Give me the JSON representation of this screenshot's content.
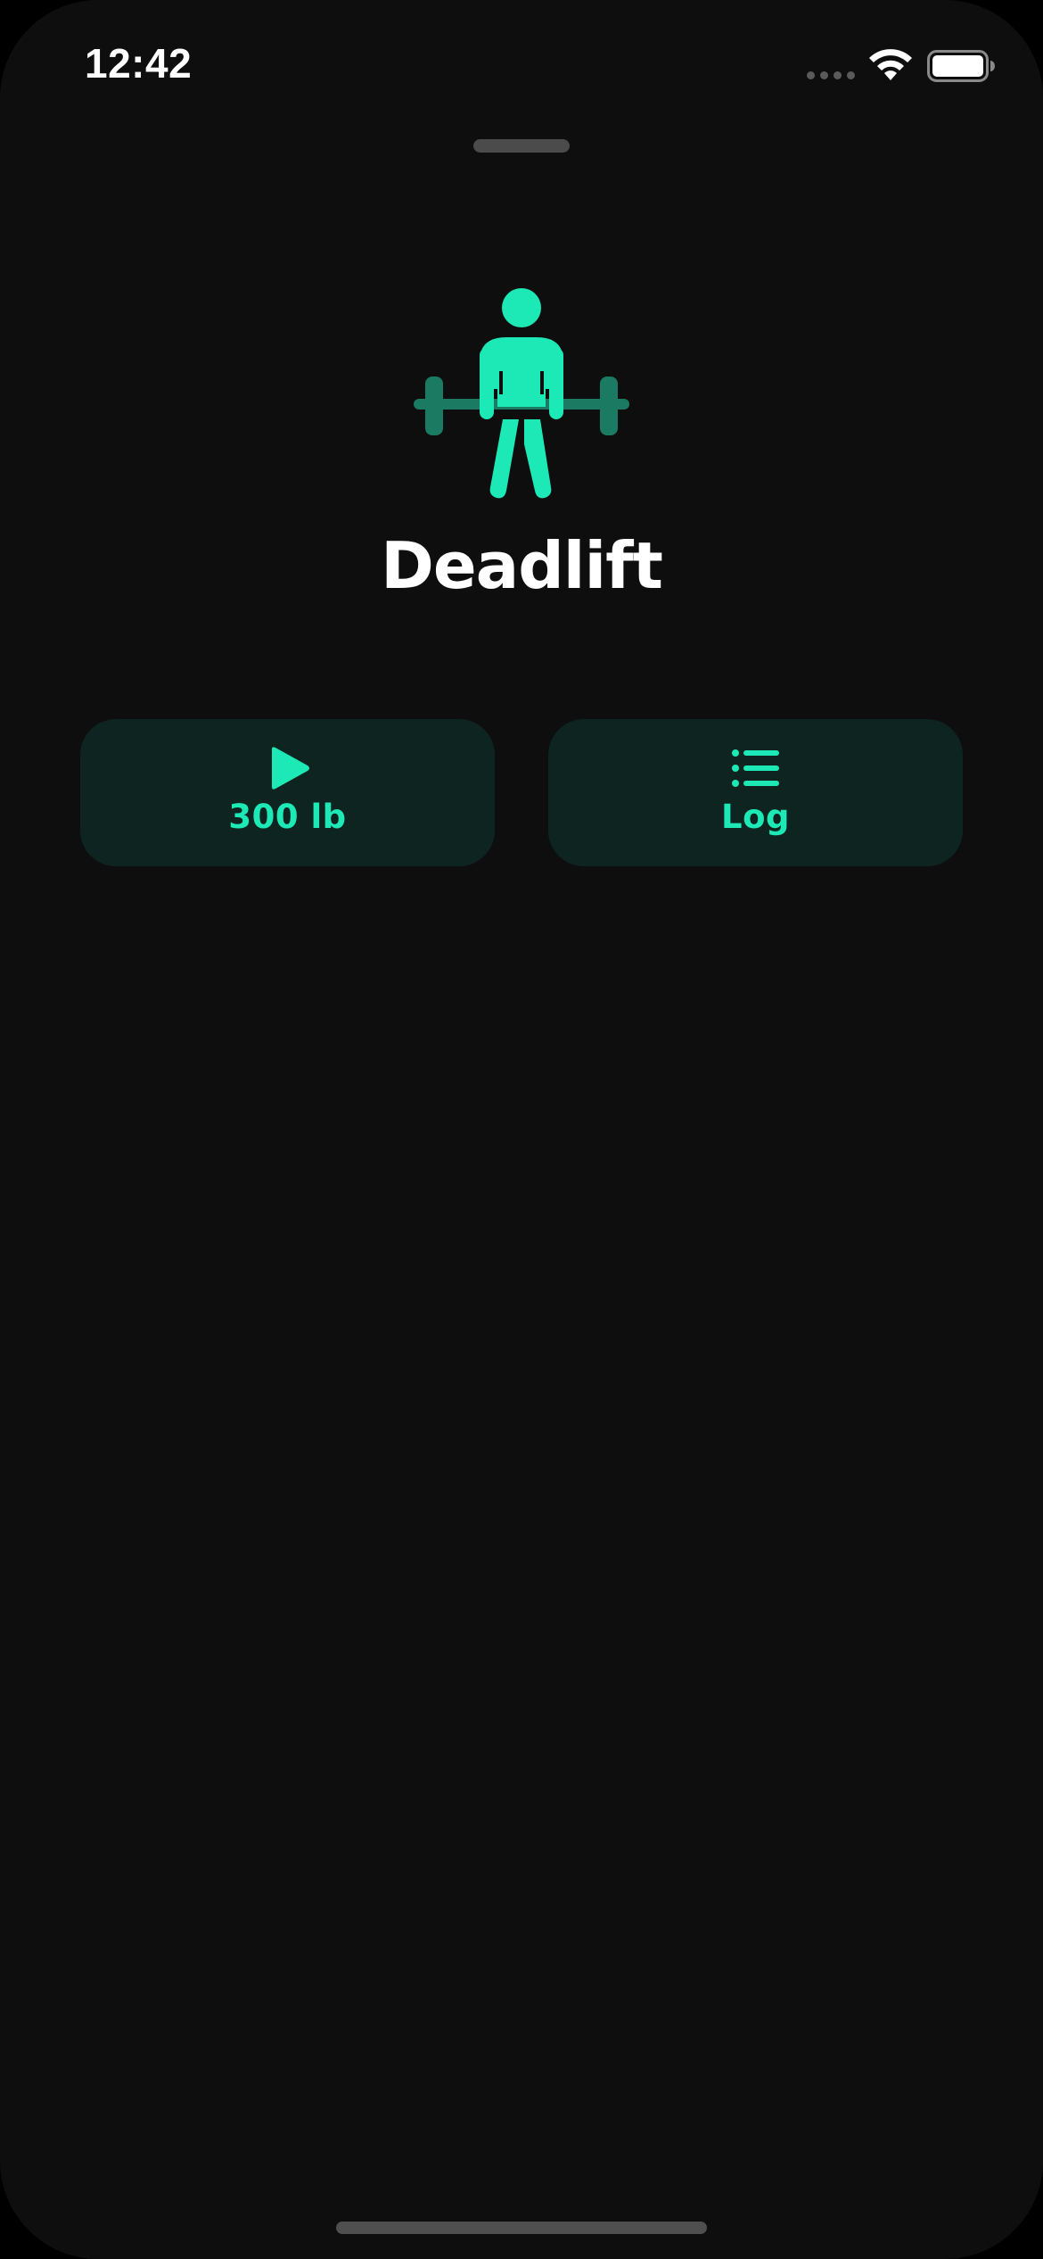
{
  "status_bar": {
    "time": "12:42"
  },
  "exercise": {
    "name": "Deadlift",
    "icon": "deadlift-person-icon"
  },
  "actions": {
    "start": {
      "label": "300 lb",
      "icon": "play-icon"
    },
    "log": {
      "label": "Log",
      "icon": "list-icon"
    }
  },
  "colors": {
    "background": "#0e0e0e",
    "accent": "#1de9b6",
    "accent_dim": "#1a7a62",
    "button_background": "#0d2420",
    "text_primary": "#ffffff"
  }
}
